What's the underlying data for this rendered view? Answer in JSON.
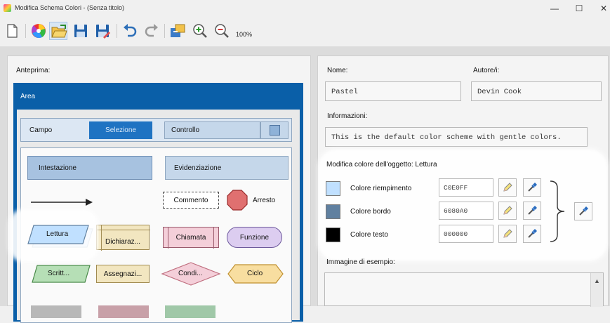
{
  "window": {
    "title": "Modifica Schema Colori - (Senza titolo)",
    "minimize_icon": "minimize-icon",
    "maximize_icon": "maximize-icon",
    "close_icon": "close-icon"
  },
  "toolbar": {
    "zoom_level": "100%",
    "icons": [
      "new-file-icon",
      "color-wheel-icon",
      "open-folder-icon",
      "save-icon",
      "save-as-icon",
      "undo-icon",
      "redo-icon",
      "export-icon",
      "zoom-in-icon",
      "zoom-out-icon"
    ]
  },
  "preview": {
    "heading": "Anteprima:",
    "area_label": "Area",
    "campo_label": "Campo",
    "selezione_label": "Selezione",
    "controllo_label": "Controllo",
    "intestazione_label": "Intestazione",
    "evidenziazione_label": "Evidenziazione",
    "commento_label": "Commento",
    "arresto_label": "Arresto",
    "lettura_label": "Lettura",
    "dichiaraz_label": "Dichiaraz...",
    "chiamata_label": "Chiamata",
    "funzione_label": "Funzione",
    "scritt_label": "Scritt...",
    "assegnazi_label": "Assegnazi...",
    "condi_label": "Condi...",
    "ciclo_label": "Ciclo"
  },
  "details": {
    "nome_label": "Nome:",
    "nome_value": "Pastel",
    "autore_label": "Autore/i:",
    "autore_value": "Devin Cook",
    "informazioni_label": "Informazioni:",
    "informazioni_value": "This is the default color scheme with gentle colors.",
    "modifica_label": "Modifica colore dell'oggetto: Lettura",
    "colors": [
      {
        "label": "Colore riempimento",
        "hex": "C0E0FF",
        "color": "#C0E0FF"
      },
      {
        "label": "Colore bordo",
        "hex": "6080A0",
        "color": "#6080A0"
      },
      {
        "label": "Colore testo",
        "hex": "000000",
        "color": "#000000"
      }
    ],
    "immagine_label": "Immagine di esempio:"
  }
}
